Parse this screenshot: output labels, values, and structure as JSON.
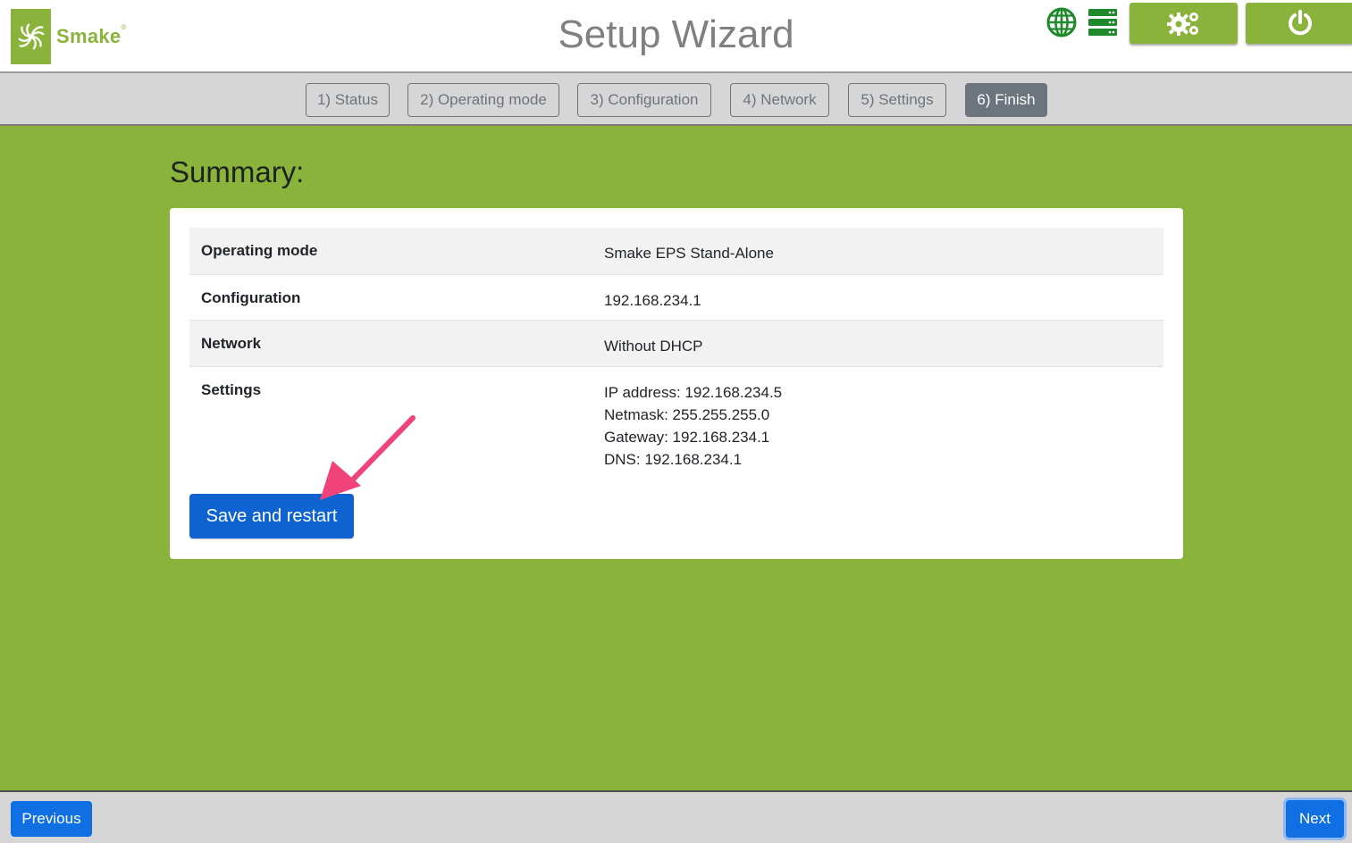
{
  "header": {
    "brand": "Smake",
    "brand_mark": "®",
    "title": "Setup Wizard",
    "icons": [
      "globe-icon",
      "server-icon",
      "settings-icon",
      "power-icon"
    ],
    "accent_color": "#8ab33c"
  },
  "steps": [
    {
      "label": "1) Status",
      "active": false
    },
    {
      "label": "2) Operating mode",
      "active": false
    },
    {
      "label": "3) Configuration",
      "active": false
    },
    {
      "label": "4) Network",
      "active": false
    },
    {
      "label": "5) Settings",
      "active": false
    },
    {
      "label": "6) Finish",
      "active": true
    }
  ],
  "summary": {
    "heading": "Summary:",
    "rows": [
      {
        "label": "Operating mode",
        "value": "Smake EPS Stand-Alone"
      },
      {
        "label": "Configuration",
        "value": "192.168.234.1"
      },
      {
        "label": "Network",
        "value": "Without DHCP"
      },
      {
        "label": "Settings",
        "values": [
          "IP address: 192.168.234.5",
          "Netmask: 255.255.255.0",
          "Gateway: 192.168.234.1",
          "DNS: 192.168.234.1"
        ]
      }
    ],
    "save_label": "Save and restart"
  },
  "footer": {
    "previous_label": "Previous",
    "next_label": "Next"
  }
}
